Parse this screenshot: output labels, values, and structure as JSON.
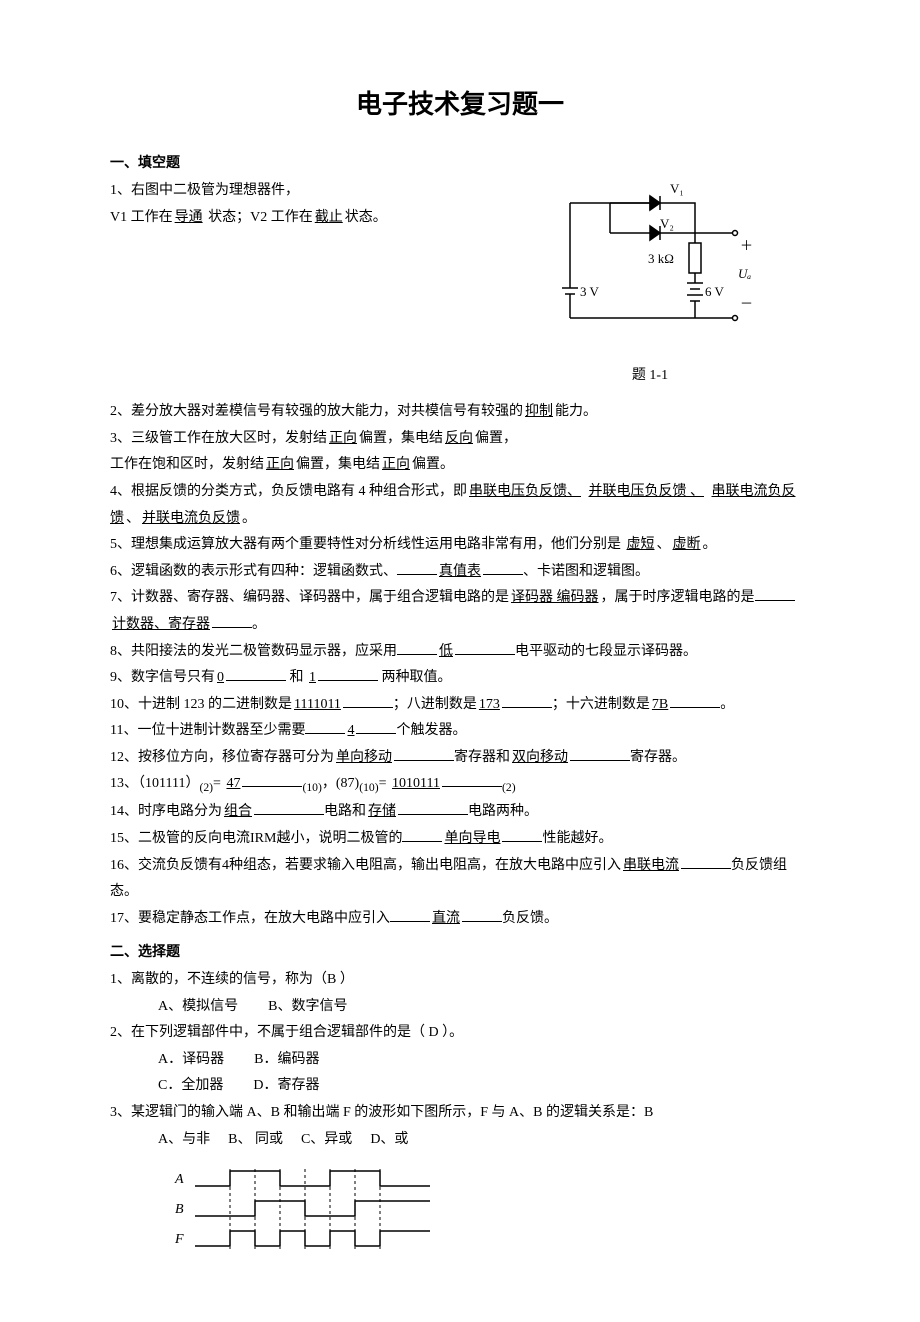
{
  "title": "电子技术复习题一",
  "section1_title": "一、填空题",
  "circuit": {
    "V1": "V₁",
    "V2": "V₂",
    "R": "3 kΩ",
    "Vleft": "3 V",
    "Vright": "6 V",
    "UA": "Uₐ",
    "plus": "＋",
    "minus": "－",
    "caption": "题 1-1"
  },
  "fill": {
    "q1a": "1、右图中二极管为理想器件，",
    "q1b_pre": "V1 工作在",
    "q1b_ans1": "导通",
    "q1b_mid": " 状态；V2 工作在",
    "q1b_ans2": "截止",
    "q1b_post": "状态。",
    "q2_pre": "2、差分放大器对差模信号有较强的放大能力，对共模信号有较强的",
    "q2_ans": "抑制",
    "q2_post": "能力。",
    "q3_pre": "3、三级管工作在放大区时，发射结",
    "q3_a1": "正向",
    "q3_m1": "偏置，集电结",
    "q3_a2": "反向",
    "q3_m2": "偏置，",
    "q3b_pre": "工作在饱和区时，发射结",
    "q3b_a1": "正向",
    "q3b_m1": "偏置，集电结",
    "q3b_a2": "正向",
    "q3b_post": "偏置。",
    "q4_pre": "4、根据反馈的分类方式，负反馈电路有 4 种组合形式，即",
    "q4_a1": "串联电压负反馈、",
    "q4_a2": "并联电压负反馈  、",
    "q4_a3": "串联电流负反馈",
    "q4_m1": "、",
    "q4_a4": "并联电流负反馈",
    "q4_post": "。",
    "q5_pre": "5、理想集成运算放大器有两个重要特性对分析线性运用电路非常有用，他们分别是",
    "q5_a1": "虚短",
    "q5_m": "、",
    "q5_a2": "虚断",
    "q5_post": "。",
    "q6_pre": "6、逻辑函数的表示形式有四种：逻辑函数式、",
    "q6_a1": "真值表",
    "q6_post": "、卡诺图和逻辑图。",
    "q7_pre": "7、计数器、寄存器、编码器、译码器中，属于组合逻辑电路的是",
    "q7_a1": "译码器   编码器",
    "q7_m1": "，属于时序逻辑电路的是",
    "q7_a2": "计数器、寄存器",
    "q7_post": "。",
    "q8_pre": "8、共阳接法的发光二极管数码显示器，应采用",
    "q8_a1": "低",
    "q8_post": "电平驱动的七段显示译码器。",
    "q9_pre": "9、数字信号只有",
    "q9_a1": "0",
    "q9_m": " 和 ",
    "q9_a2": "1",
    "q9_post": " 两种取值。",
    "q10_pre": "10、十进制 123 的二进制数是",
    "q10_a1": "1111011",
    "q10_m1": "；八进制数是",
    "q10_a2": "173",
    "q10_m2": "；十六进制数是",
    "q10_a3": "7B",
    "q10_post": "。",
    "q11_pre": "11、一位十进制计数器至少需要",
    "q11_a1": "4",
    "q11_post": "个触发器。",
    "q12_pre": "12、按移位方向，移位寄存器可分为",
    "q12_a1": "单向移动",
    "q12_m": "寄存器和",
    "q12_a2": "双向移动",
    "q12_post": "寄存器。",
    "q13_pre": "13、（101111）",
    "q13_sub1": "(2)",
    "q13_eq": "= ",
    "q13_a1": "47",
    "q13_sub2": "(10)",
    "q13_m": "，(87)",
    "q13_sub3": "(10)",
    "q13_eq2": "= ",
    "q13_a2": "1010111",
    "q13_sub4": "(2)",
    "q14_pre": "14、时序电路分为",
    "q14_a1": "组合",
    "q14_m": "电路和",
    "q14_a2": "存储",
    "q14_post": "电路两种。",
    "q15_pre": "15、二极管的反向电流IRM越小，说明二极管的",
    "q15_a1": "单向导电",
    "q15_post": "性能越好。",
    "q16_pre": "16、交流负反馈有4种组态，若要求输入电阻高，输出电阻高，在放大电路中应引入",
    "q16_a1": "串联电流",
    "q16_post": "负反馈组态。",
    "q17_pre": "17、要稳定静态工作点，在放大电路中应引入",
    "q17_a1": "直流",
    "q17_post": "负反馈。"
  },
  "section2_title": "二、选择题",
  "choice": {
    "q1": "1、离散的，不连续的信号，称为（B    ）",
    "q1a": "A、模拟信号",
    "q1b": "B、数字信号",
    "q2": "2、在下列逻辑部件中，不属于组合逻辑部件的是（   D   ）。",
    "q2a": "A．译码器",
    "q2b": "B．编码器",
    "q2c": "C．全加器",
    "q2d": "D．寄存器",
    "q3": "3、某逻辑门的输入端 A、B 和输出端 F 的波形如下图所示，F 与 A、B 的逻辑关系是：B",
    "q3a": "A、与非",
    "q3b": "B、 同或",
    "q3c": "C、异或",
    "q3d": "D、或"
  },
  "wave": {
    "A": "A",
    "B": "B",
    "F": "F"
  }
}
